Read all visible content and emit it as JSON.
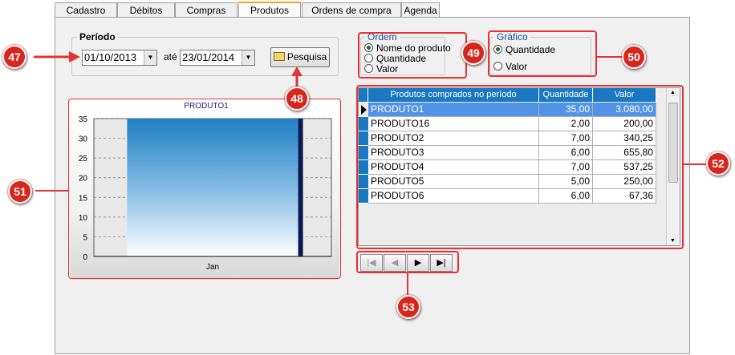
{
  "tabs": [
    "Cadastro",
    "Débitos",
    "Compras",
    "Produtos",
    "Ordens de compra",
    "Agenda"
  ],
  "active_tab": "Produtos",
  "periodo": {
    "title": "Período",
    "start_date": "01/10/2013",
    "separator": "até",
    "end_date": "23/01/2014",
    "search_button": "Pesquisa"
  },
  "ordem": {
    "title": "Ordem",
    "options": [
      "Nome do produto",
      "Quantidade",
      "Valor"
    ],
    "selected": "Nome do produto"
  },
  "grafico": {
    "title": "Gráfico",
    "options": [
      "Quantidade",
      "Valor"
    ],
    "selected": "Quantidade"
  },
  "chart": {
    "title": "PRODUTO1",
    "yticks": [
      "35",
      "30",
      "25",
      "20",
      "15",
      "10",
      "5",
      "0"
    ],
    "category": "Jan"
  },
  "chart_data": {
    "type": "bar",
    "title": "PRODUTO1",
    "categories": [
      "Jan"
    ],
    "values": [
      35
    ],
    "ylim": [
      0,
      35
    ],
    "grid": true
  },
  "table": {
    "headers": [
      "Produtos comprados no período",
      "Quantidade",
      "Valor"
    ],
    "rows": [
      [
        "PRODUTO1",
        "35,00",
        "3.080,00"
      ],
      [
        "PRODUTO16",
        "2,00",
        "200,00"
      ],
      [
        "PRODUTO2",
        "7,00",
        "340,25"
      ],
      [
        "PRODUTO3",
        "6,00",
        "655,80"
      ],
      [
        "PRODUTO4",
        "7,00",
        "537,25"
      ],
      [
        "PRODUTO5",
        "5,00",
        "250,00"
      ],
      [
        "PRODUTO6",
        "6,00",
        "67,36"
      ]
    ],
    "selected_row": 0
  },
  "nav_buttons": [
    "|◀",
    "◀",
    "▶",
    "▶|"
  ],
  "badges": [
    "47",
    "48",
    "49",
    "50",
    "51",
    "52",
    "53"
  ],
  "colors": {
    "annotation_red": "#e53232",
    "header_blue": "#1a78c2",
    "selection_blue": "#5193e6"
  }
}
